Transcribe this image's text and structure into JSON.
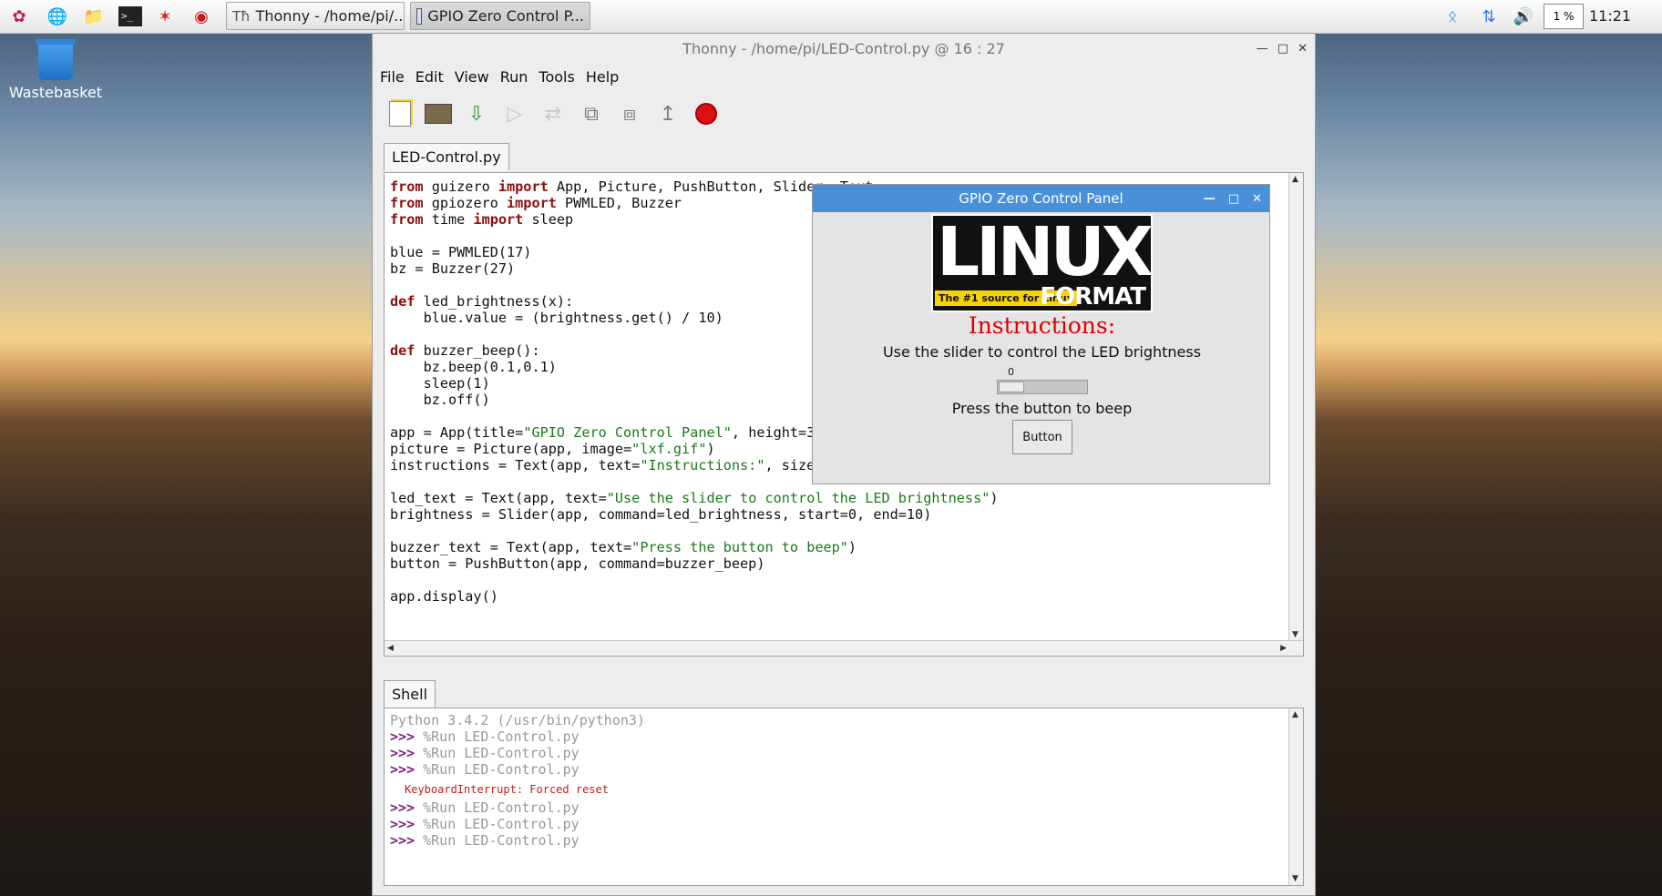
{
  "taskbar": {
    "tasks": [
      {
        "label": "Thonny  -  /home/pi/..."
      },
      {
        "label": "GPIO Zero Control P..."
      }
    ],
    "cpu": "1 %",
    "clock": "11:21"
  },
  "desktop": {
    "trash_label": "Wastebasket"
  },
  "thonny": {
    "title": "Thonny  -  /home/pi/LED-Control.py  @  16 : 27",
    "menu": [
      "File",
      "Edit",
      "View",
      "Run",
      "Tools",
      "Help"
    ],
    "editor_tab": "LED-Control.py",
    "shell_tab": "Shell",
    "code": [
      [
        [
          "kw",
          "from"
        ],
        [
          "t",
          " guizero "
        ],
        [
          "kw",
          "import"
        ],
        [
          "t",
          " App, Picture, PushButton, Slider, Text"
        ]
      ],
      [
        [
          "kw",
          "from"
        ],
        [
          "t",
          " gpiozero "
        ],
        [
          "kw",
          "import"
        ],
        [
          "t",
          " PWMLED, Buzzer"
        ]
      ],
      [
        [
          "kw",
          "from"
        ],
        [
          "t",
          " time "
        ],
        [
          "kw",
          "import"
        ],
        [
          "t",
          " sleep"
        ]
      ],
      [
        [
          "t",
          ""
        ]
      ],
      [
        [
          "t",
          "blue = PWMLED(17)"
        ]
      ],
      [
        [
          "t",
          "bz = Buzzer(27)"
        ]
      ],
      [
        [
          "t",
          ""
        ]
      ],
      [
        [
          "kw",
          "def"
        ],
        [
          "t",
          " led_brightness(x):"
        ]
      ],
      [
        [
          "t",
          "    blue.value = (brightness.get() / 10)"
        ]
      ],
      [
        [
          "t",
          ""
        ]
      ],
      [
        [
          "kw",
          "def"
        ],
        [
          "t",
          " buzzer_beep():"
        ]
      ],
      [
        [
          "t",
          "    bz.beep(0.1,0.1)"
        ]
      ],
      [
        [
          "t",
          "    sleep(1)"
        ]
      ],
      [
        [
          "t",
          "    bz.off()"
        ]
      ],
      [
        [
          "t",
          ""
        ]
      ],
      [
        [
          "t",
          "app = App(title="
        ],
        [
          "str",
          "\"GPIO Zero Control Panel\""
        ],
        [
          "t",
          ", height=300, width=500)"
        ]
      ],
      [
        [
          "t",
          "picture = Picture(app, image="
        ],
        [
          "str",
          "\"lxf.gif\""
        ],
        [
          "t",
          ")"
        ]
      ],
      [
        [
          "t",
          "instructions = Text(app, text="
        ],
        [
          "str",
          "\"Instructions:\""
        ],
        [
          "t",
          ", size=20, color=\"red\")"
        ]
      ],
      [
        [
          "t",
          ""
        ]
      ],
      [
        [
          "t",
          "led_text = Text(app, text="
        ],
        [
          "str",
          "\"Use the slider to control the LED brightness\""
        ],
        [
          "t",
          ")"
        ]
      ],
      [
        [
          "t",
          "brightness = Slider(app, command=led_brightness, start=0, end=10)"
        ]
      ],
      [
        [
          "t",
          ""
        ]
      ],
      [
        [
          "t",
          "buzzer_text = Text(app, text="
        ],
        [
          "str",
          "\"Press the button to beep\""
        ],
        [
          "t",
          ")"
        ]
      ],
      [
        [
          "t",
          "button = PushButton(app, command=buzzer_beep)"
        ]
      ],
      [
        [
          "t",
          ""
        ]
      ],
      [
        [
          "t",
          "app.display()"
        ]
      ]
    ],
    "shell": {
      "header": "Python 3.4.2 (/usr/bin/python3)",
      "prompt": ">>>",
      "run_cmd": " %Run LED-Control.py",
      "error": "KeyboardInterrupt: Forced reset"
    }
  },
  "gpio_panel": {
    "title": "GPIO Zero Control Panel",
    "logo_text": "LINUX",
    "logo_sub": "FORMAT",
    "logo_tag": "The #1 source for Linux",
    "instructions": "Instructions:",
    "led_text": "Use the slider to control the LED brightness",
    "slider_value": "0",
    "slider_fraction": 0.0,
    "buzzer_text": "Press the button to beep",
    "button_label": "Button"
  }
}
